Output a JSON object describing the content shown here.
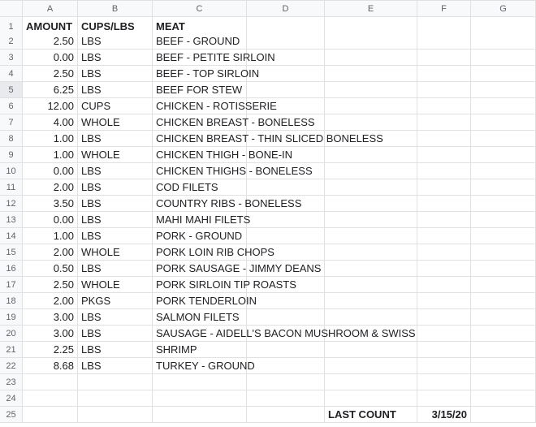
{
  "columns": [
    "A",
    "B",
    "C",
    "D",
    "E",
    "F",
    "G"
  ],
  "header_row": {
    "amount": "AMOUNT",
    "cups_lbs": "CUPS/LBS",
    "meat": "MEAT"
  },
  "rows": [
    {
      "n": "2",
      "amount": "2.50",
      "unit": "LBS",
      "meat": "BEEF - GROUND"
    },
    {
      "n": "3",
      "amount": "0.00",
      "unit": "LBS",
      "meat": "BEEF - PETITE SIRLOIN"
    },
    {
      "n": "4",
      "amount": "2.50",
      "unit": "LBS",
      "meat": "BEEF - TOP SIRLOIN"
    },
    {
      "n": "5",
      "amount": "6.25",
      "unit": "LBS",
      "meat": "BEEF FOR STEW",
      "selected": true
    },
    {
      "n": "6",
      "amount": "12.00",
      "unit": "CUPS",
      "meat": "CHICKEN - ROTISSERIE"
    },
    {
      "n": "7",
      "amount": "4.00",
      "unit": "WHOLE",
      "meat": "CHICKEN BREAST - BONELESS"
    },
    {
      "n": "8",
      "amount": "1.00",
      "unit": "LBS",
      "meat": "CHICKEN BREAST - THIN SLICED BONELESS"
    },
    {
      "n": "9",
      "amount": "1.00",
      "unit": "WHOLE",
      "meat": "CHICKEN THIGH - BONE-IN"
    },
    {
      "n": "10",
      "amount": "0.00",
      "unit": "LBS",
      "meat": "CHICKEN THIGHS - BONELESS"
    },
    {
      "n": "11",
      "amount": "2.00",
      "unit": "LBS",
      "meat": "COD FILETS"
    },
    {
      "n": "12",
      "amount": "3.50",
      "unit": "LBS",
      "meat": "COUNTRY RIBS - BONELESS"
    },
    {
      "n": "13",
      "amount": "0.00",
      "unit": "LBS",
      "meat": "MAHI MAHI FILETS"
    },
    {
      "n": "14",
      "amount": "1.00",
      "unit": "LBS",
      "meat": "PORK - GROUND"
    },
    {
      "n": "15",
      "amount": "2.00",
      "unit": "WHOLE",
      "meat": "PORK LOIN RIB CHOPS"
    },
    {
      "n": "16",
      "amount": "0.50",
      "unit": "LBS",
      "meat": "PORK SAUSAGE - JIMMY DEANS"
    },
    {
      "n": "17",
      "amount": "2.50",
      "unit": "WHOLE",
      "meat": "PORK SIRLOIN TIP ROASTS"
    },
    {
      "n": "18",
      "amount": "2.00",
      "unit": "PKGS",
      "meat": "PORK TENDERLOIN"
    },
    {
      "n": "19",
      "amount": "3.00",
      "unit": "LBS",
      "meat": "SALMON FILETS"
    },
    {
      "n": "20",
      "amount": "3.00",
      "unit": "LBS",
      "meat": "SAUSAGE - AIDELL'S BACON MUSHROOM & SWISS"
    },
    {
      "n": "21",
      "amount": "2.25",
      "unit": "LBS",
      "meat": "SHRIMP"
    },
    {
      "n": "22",
      "amount": "8.68",
      "unit": "LBS",
      "meat": "TURKEY - GROUND"
    }
  ],
  "empty_rows": [
    "23",
    "24"
  ],
  "footer": {
    "n": "25",
    "label": "LAST COUNT",
    "date": "3/15/20"
  },
  "chart_data": {
    "type": "table",
    "columns": [
      "AMOUNT",
      "CUPS/LBS",
      "MEAT"
    ],
    "rows": [
      [
        2.5,
        "LBS",
        "BEEF - GROUND"
      ],
      [
        0.0,
        "LBS",
        "BEEF - PETITE SIRLOIN"
      ],
      [
        2.5,
        "LBS",
        "BEEF - TOP SIRLOIN"
      ],
      [
        6.25,
        "LBS",
        "BEEF FOR STEW"
      ],
      [
        12.0,
        "CUPS",
        "CHICKEN - ROTISSERIE"
      ],
      [
        4.0,
        "WHOLE",
        "CHICKEN BREAST - BONELESS"
      ],
      [
        1.0,
        "LBS",
        "CHICKEN BREAST - THIN SLICED BONELESS"
      ],
      [
        1.0,
        "WHOLE",
        "CHICKEN THIGH - BONE-IN"
      ],
      [
        0.0,
        "LBS",
        "CHICKEN THIGHS - BONELESS"
      ],
      [
        2.0,
        "LBS",
        "COD FILETS"
      ],
      [
        3.5,
        "LBS",
        "COUNTRY RIBS - BONELESS"
      ],
      [
        0.0,
        "LBS",
        "MAHI MAHI FILETS"
      ],
      [
        1.0,
        "LBS",
        "PORK - GROUND"
      ],
      [
        2.0,
        "WHOLE",
        "PORK LOIN RIB CHOPS"
      ],
      [
        0.5,
        "LBS",
        "PORK SAUSAGE - JIMMY DEANS"
      ],
      [
        2.5,
        "WHOLE",
        "PORK SIRLOIN TIP ROASTS"
      ],
      [
        2.0,
        "PKGS",
        "PORK TENDERLOIN"
      ],
      [
        3.0,
        "LBS",
        "SALMON FILETS"
      ],
      [
        3.0,
        "LBS",
        "SAUSAGE - AIDELL'S BACON MUSHROOM & SWISS"
      ],
      [
        2.25,
        "LBS",
        "SHRIMP"
      ],
      [
        8.68,
        "LBS",
        "TURKEY - GROUND"
      ]
    ],
    "footer": {
      "E": "LAST COUNT",
      "F": "3/15/20"
    }
  }
}
